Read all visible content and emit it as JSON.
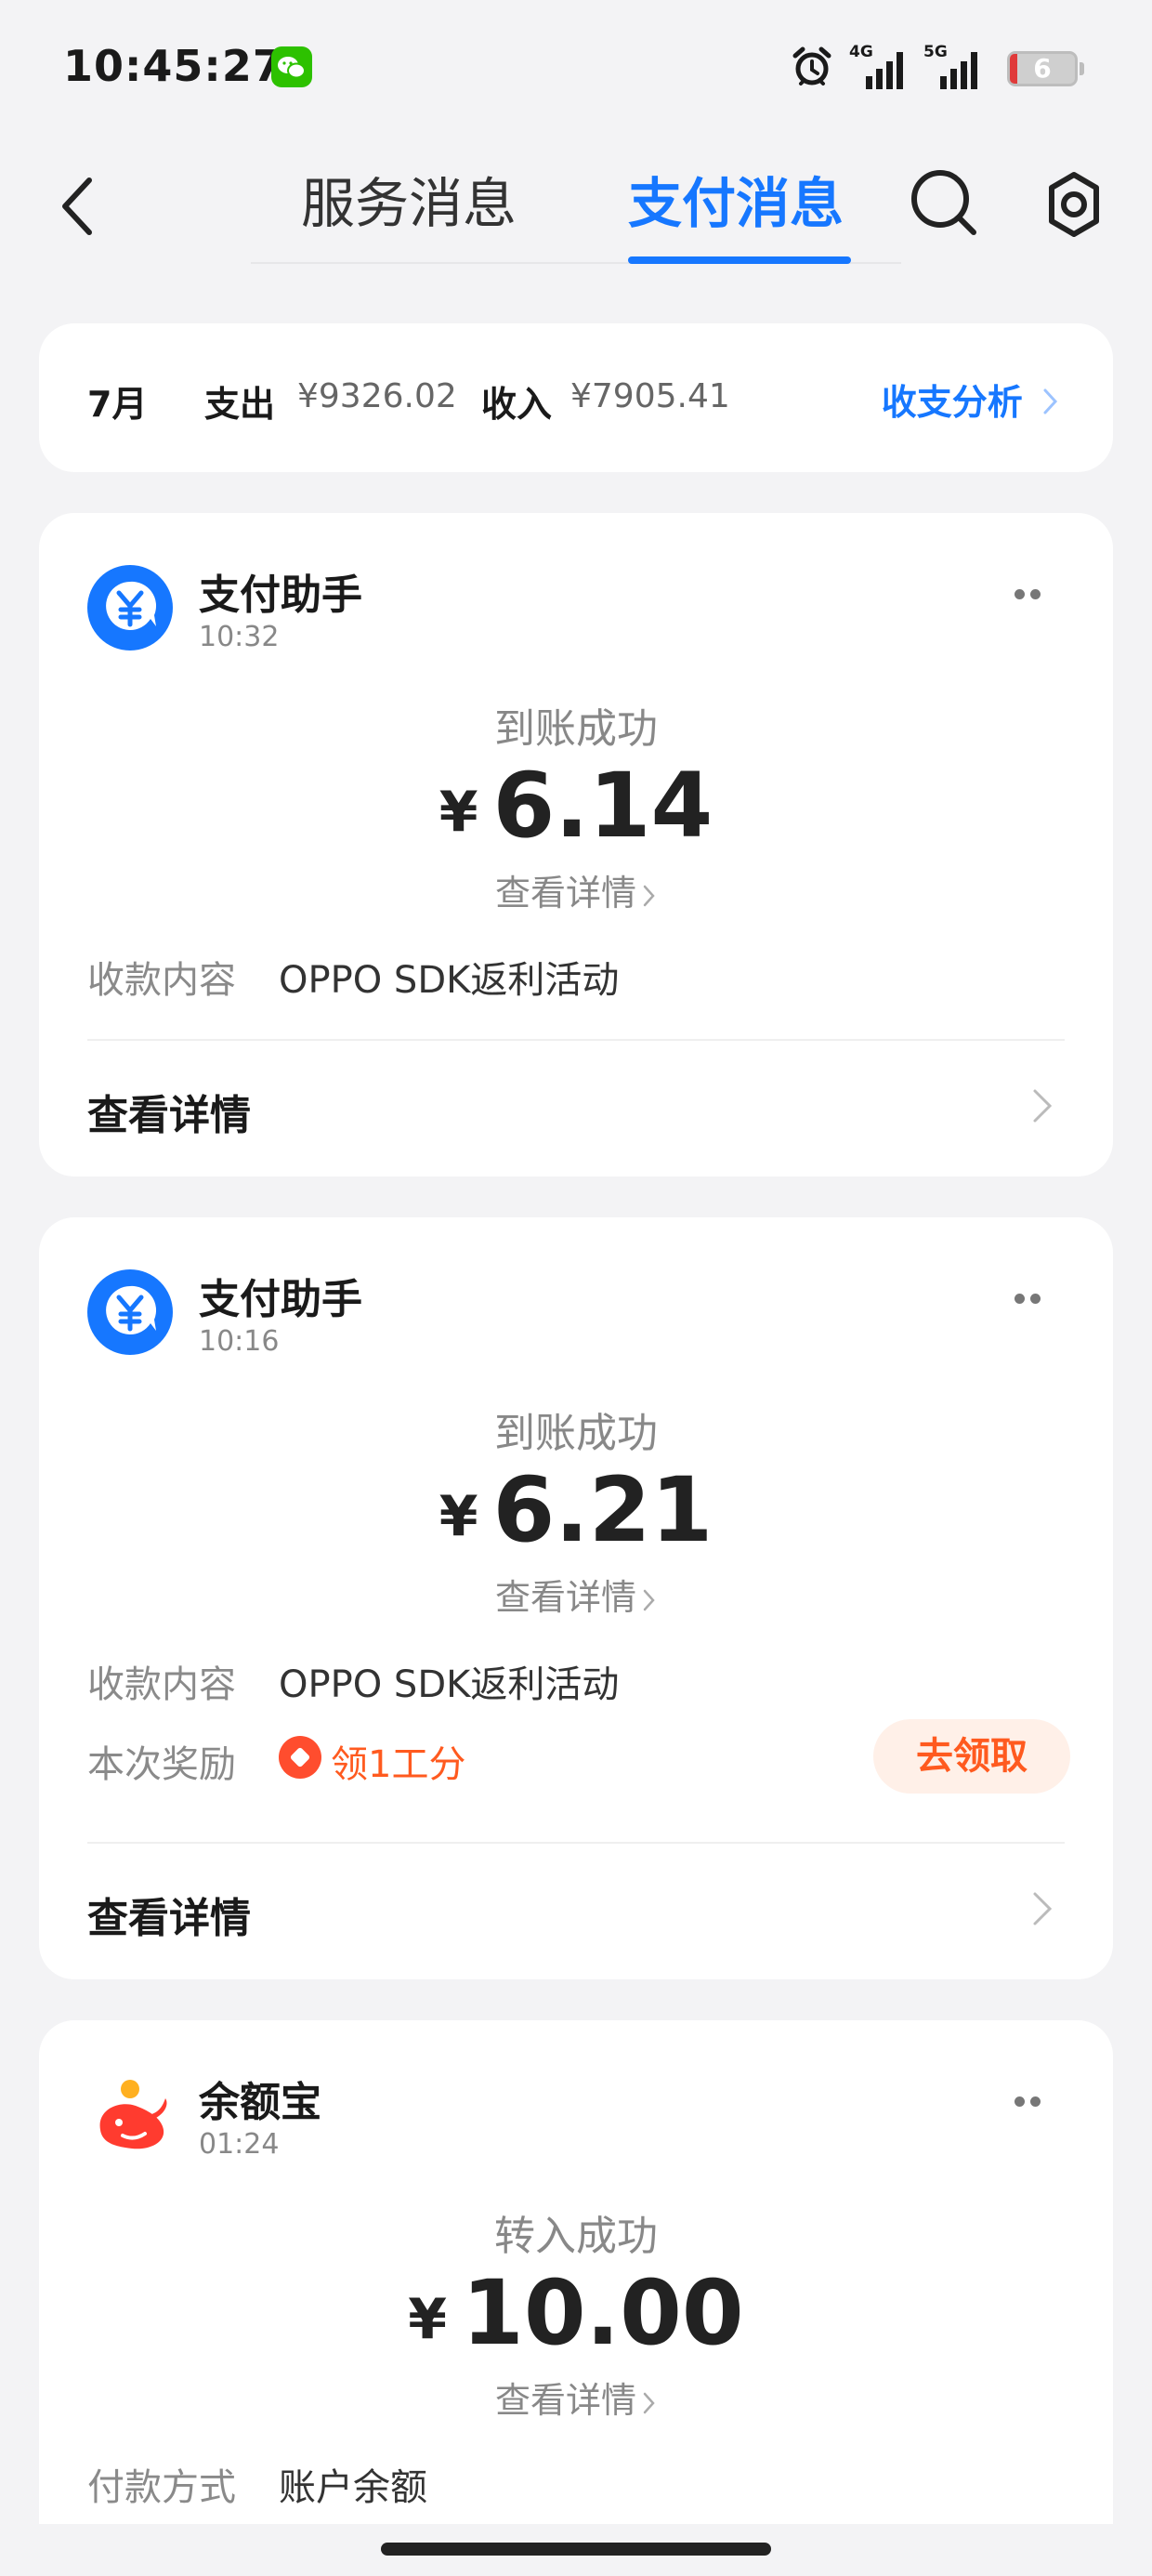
{
  "status_bar": {
    "time": "10:45:27",
    "network_1": "4G",
    "network_2": "5G",
    "battery": "6",
    "icons": [
      "wechat-icon",
      "alarm-icon",
      "signal-icon",
      "battery-icon"
    ]
  },
  "nav": {
    "tabs": [
      {
        "label": "服务消息",
        "active": false
      },
      {
        "label": "支付消息",
        "active": true
      }
    ],
    "icons": [
      "back-icon",
      "search-icon",
      "gear-icon"
    ],
    "accent_color": "#1677ff"
  },
  "summary": {
    "month": "7月",
    "expense_label": "支出",
    "expense_value": "¥9326.02",
    "income_label": "收入",
    "income_value": "¥7905.41",
    "analysis_link": "收支分析"
  },
  "messages": [
    {
      "sender": "支付助手",
      "time": "10:32",
      "status": "到账成功",
      "currency": "¥",
      "amount": "6.14",
      "detail_link": "查看详情",
      "rows": [
        {
          "label": "收款内容",
          "value": "OPPO SDK返利活动"
        }
      ],
      "footer": "查看详情"
    },
    {
      "sender": "支付助手",
      "time": "10:16",
      "status": "到账成功",
      "currency": "¥",
      "amount": "6.21",
      "detail_link": "查看详情",
      "rows": [
        {
          "label": "收款内容",
          "value": "OPPO SDK返利活动"
        }
      ],
      "reward": {
        "label": "本次奖励",
        "text": "领1工分",
        "button": "去领取",
        "color": "#ff5a1f"
      },
      "footer": "查看详情"
    },
    {
      "sender": "余额宝",
      "time": "01:24",
      "status": "转入成功",
      "currency": "¥",
      "amount": "10.00",
      "detail_link": "查看详情",
      "rows": [
        {
          "label": "付款方式",
          "value": "账户余额"
        }
      ]
    }
  ]
}
